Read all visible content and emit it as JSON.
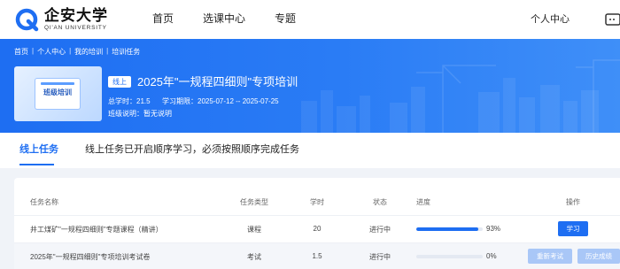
{
  "brand": {
    "name": "企安大学",
    "en": "QI'AN UNIVERSITY"
  },
  "nav": {
    "items": [
      "首页",
      "选课中心",
      "专题"
    ],
    "user": "个人中心"
  },
  "breadcrumb": [
    "首页",
    "个人中心",
    "我的培训",
    "培训任务"
  ],
  "course": {
    "cover_label": "班级培训",
    "tag": "线上",
    "title": "2025年\"一规程四细则\"专项培训",
    "total_hours": "总学时：21.5",
    "period": "学习期限：2025-07-12 -- 2025-07-25",
    "class_note": "班级说明：暂无说明"
  },
  "tabs": {
    "active": "线上任务",
    "tip": "线上任务已开启顺序学习，必须按照顺序完成任务"
  },
  "table": {
    "columns": [
      "任务名称",
      "任务类型",
      "学时",
      "状态",
      "进度",
      "操作"
    ],
    "rows": [
      {
        "name": "井工煤矿\"一规程四细则\"专题课程（精讲）",
        "type": "课程",
        "hours": "20",
        "status": "进行中",
        "progress": 93,
        "progress_text": "93%",
        "actions": [
          "学习"
        ]
      },
      {
        "name": "2025年\"一规程四细则\"专项培训考试卷",
        "type": "考试",
        "hours": "1.5",
        "status": "进行中",
        "progress": 0,
        "progress_text": "0%",
        "actions": [
          "重新考试",
          "历史成绩"
        ]
      }
    ]
  },
  "colors": {
    "primary": "#1e6ef2",
    "disabled": "#a9c7f7"
  }
}
